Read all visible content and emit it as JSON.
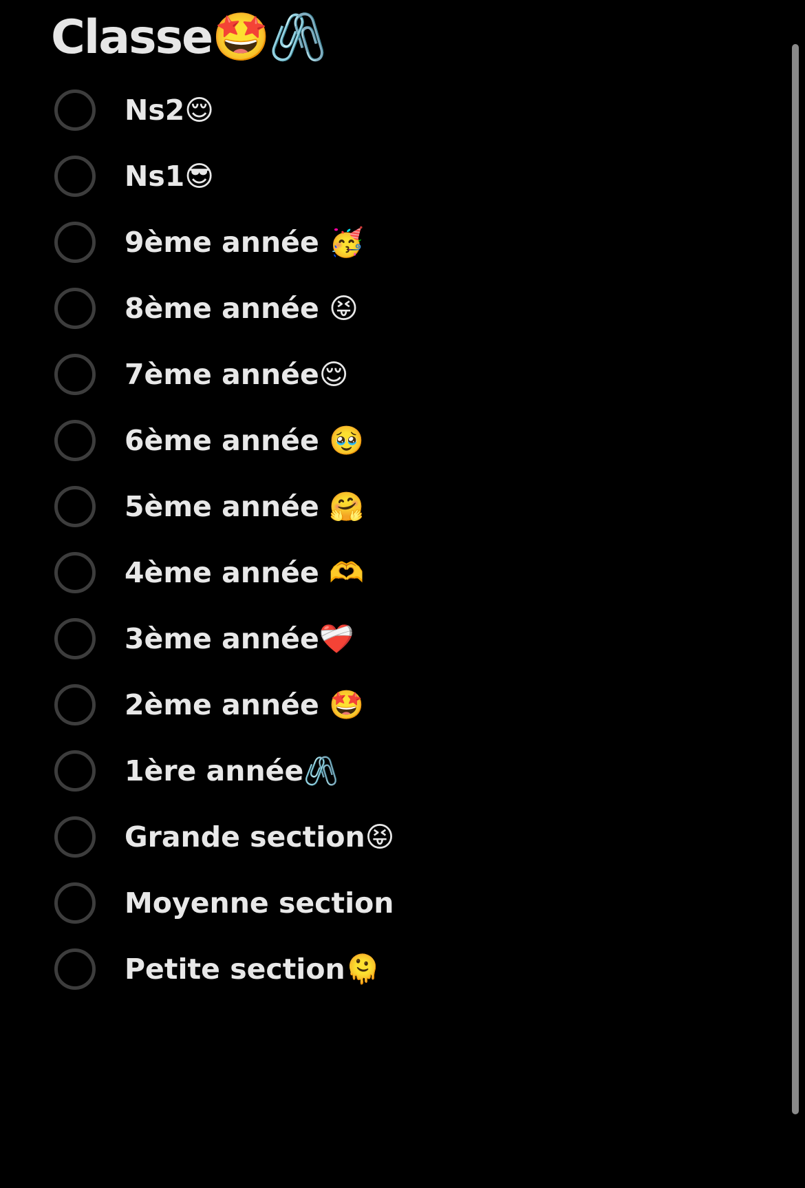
{
  "form": {
    "title": "Classe🤩🖇️",
    "options": [
      {
        "label": "Ns2😌"
      },
      {
        "label": "Ns1😎"
      },
      {
        "label": "9ème année 🥳"
      },
      {
        "label": "8ème année 😝"
      },
      {
        "label": "7ème année😌"
      },
      {
        "label": "6ème année 🥹"
      },
      {
        "label": "5ème année 🤗"
      },
      {
        "label": "4ème année 🫶"
      },
      {
        "label": "3ème année❤️‍🩹"
      },
      {
        "label": "2ème année 🤩"
      },
      {
        "label": "1ère année🖇️"
      },
      {
        "label": "Grande section😝"
      },
      {
        "label": "Moyenne section"
      },
      {
        "label": "Petite section🫠"
      }
    ]
  }
}
